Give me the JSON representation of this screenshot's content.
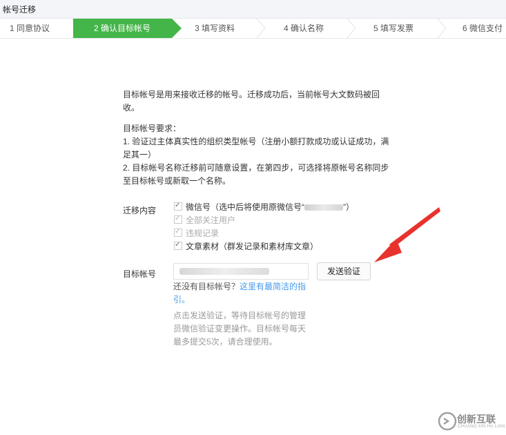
{
  "window": {
    "title": "帐号迁移"
  },
  "steps": [
    {
      "label": "1 同意协议",
      "active": false
    },
    {
      "label": "2 确认目标帐号",
      "active": true
    },
    {
      "label": "3 填写资料",
      "active": false
    },
    {
      "label": "4 确认名称",
      "active": false
    },
    {
      "label": "5 填写发票",
      "active": false
    },
    {
      "label": "6 微信支付",
      "active": false
    }
  ],
  "intro": {
    "line1": "目标帐号是用来接收迁移的帐号。迁移成功后，当前帐号大文数码被回",
    "line2": "收。"
  },
  "requirements": {
    "heading": "目标帐号要求：",
    "item1_line1": "1. 验证过主体真实性的组织类型帐号（注册小额打款成功或认证成功，满",
    "item1_line2": "足其一）",
    "item2_line1": "2. 目标帐号名称迁移前可随意设置，在第四步，可选择将原帐号名称同步",
    "item2_line2": "至目标帐号或新取一个名称。"
  },
  "migration": {
    "label": "迁移内容",
    "options": [
      {
        "text_before": "微信号（选中后将使用原微信号“",
        "text_after": "”）",
        "checked": true,
        "disabled": false
      },
      {
        "text": "全部关注用户",
        "checked": true,
        "disabled": true
      },
      {
        "text": "违规记录",
        "checked": true,
        "disabled": true
      },
      {
        "text": "文章素材（群发记录和素材库文章）",
        "checked": true,
        "disabled": false
      }
    ]
  },
  "target": {
    "label": "目标帐号",
    "send_button": "发送验证",
    "no_account_text": "还没有目标帐号？",
    "guide_link_line1": "这里有最简洁的指",
    "guide_link_line2": "引。",
    "note_line1": "点击发送验证，等待目标帐号的管理",
    "note_line2": "员微信验证变更操作。目标帐号每天",
    "note_line3": "最多提交5次，请合理使用。"
  },
  "watermark": {
    "text": "创新互联",
    "sub": "CHUANG XIN HU LIAN"
  },
  "colors": {
    "accent": "#44b549",
    "link": "#459ae9",
    "arrow": "#e8322d"
  }
}
